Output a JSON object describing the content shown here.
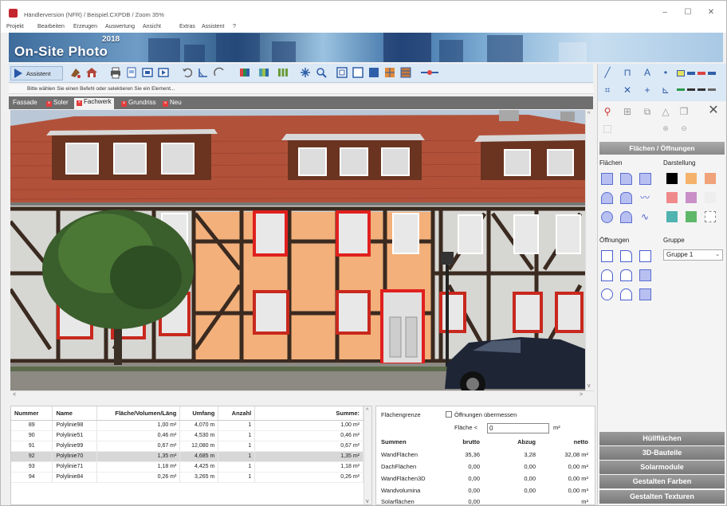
{
  "window": {
    "title": "Händlerversion (NFR) / Beispiel.CXPDB / Zoom 35%"
  },
  "menu": [
    "Projekt",
    "Bearbeiten",
    "Erzeugen",
    "Auswertung",
    "Ansicht",
    "Extras",
    "Assistent",
    "?"
  ],
  "banner": {
    "title": "On-Site Photo",
    "year": "2018"
  },
  "toolbar": {
    "assistent_label": "Assistent"
  },
  "hint": "Bitte wählen Sie einen Befehl oder selektieren Sie ein Element...",
  "tabs": [
    "Fassade",
    "Soler",
    "Fachwerk",
    "Grundriss",
    "Neu"
  ],
  "active_tab": "Fachwerk",
  "right_panel": {
    "section_title": "Flächen / Öffnungen",
    "flaechen_label": "Flächen",
    "darstellung_label": "Darstellung",
    "oeffnungen_label": "Öffnungen",
    "gruppe_label": "Gruppe",
    "gruppe_value": "Gruppe 1",
    "swatch_colors": [
      "#000000",
      "#f4b26a",
      "#f0a27a",
      "#f08a8a",
      "#c98fc8",
      "#eeeeee",
      "#4fb3b0",
      "#5fb86a"
    ],
    "bottom_buttons": [
      "Hüllflächen",
      "3D-Bauteile",
      "Solarmodule",
      "Gestalten Farben",
      "Gestalten Texturen"
    ]
  },
  "table": {
    "headers": [
      "Nummer",
      "Name",
      "Fläche/Volumen/Läng",
      "Umfang",
      "Anzahl",
      "Summe:"
    ],
    "rows": [
      [
        "89",
        "Polylinie98",
        "1,00 m²",
        "4,070 m",
        "1",
        "1,00 m²"
      ],
      [
        "90",
        "Polylinie51",
        "0,46 m²",
        "4,530 m",
        "1",
        "0,46 m²"
      ],
      [
        "91",
        "Polylinie99",
        "0,67 m²",
        "12,080 m",
        "1",
        "0,67 m²"
      ],
      [
        "92",
        "Polylinie70",
        "1,35 m²",
        "4,685 m",
        "1",
        "1,35 m²"
      ],
      [
        "93",
        "Polylinie71",
        "1,18 m²",
        "4,425 m",
        "1",
        "1,18 m²"
      ],
      [
        "94",
        "Polylinie84",
        "0,26 m²",
        "3,265 m",
        "1",
        "0,26 m²"
      ]
    ],
    "selected_index": 3
  },
  "summary": {
    "flaechengrenze_label": "Flächengrenze",
    "oeffnungen_checkbox_label": "Öffnungen übermessen",
    "flaeche_label": "Fläche <",
    "flaeche_value": "0",
    "flaeche_unit": "m²",
    "headers": [
      "Summen",
      "brutto",
      "Abzug",
      "netto"
    ],
    "rows": [
      [
        "WandFlächen",
        "35,36",
        "3,28",
        "32,08 m²"
      ],
      [
        "DachFlächen",
        "0,00",
        "0,00",
        "0,00 m²"
      ],
      [
        "WandFlächen3D",
        "0,00",
        "0,00",
        "0,00 m²"
      ],
      [
        "Wandvolumina",
        "0,00",
        "0,00",
        "0,00 m³"
      ],
      [
        "Solarflächen",
        "0,00",
        "",
        "m²"
      ]
    ]
  }
}
